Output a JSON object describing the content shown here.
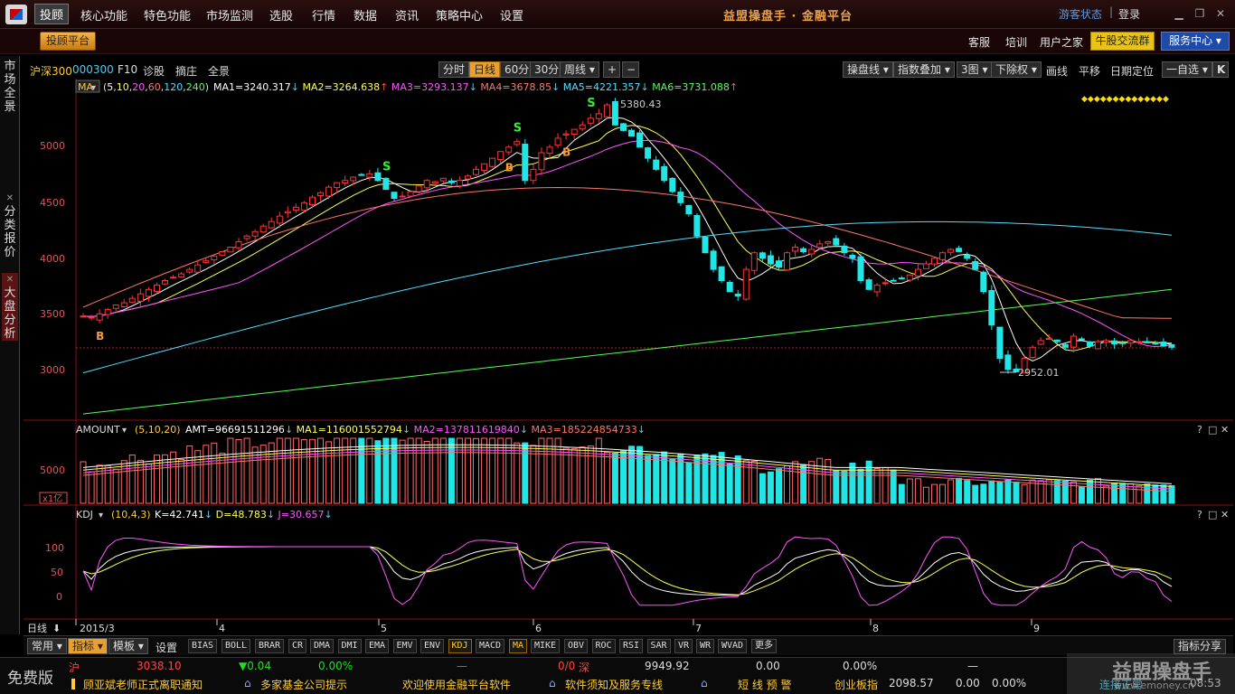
{
  "menu": {
    "items": [
      "投顾",
      "核心功能",
      "特色功能",
      "市场监测",
      "选股",
      "行情",
      "数据",
      "资讯",
      "策略中心",
      "设置"
    ],
    "app_title": "益盟操盘手 · 金融平台",
    "guest_status": "游客状态",
    "separator": "|",
    "login": "登录"
  },
  "toolbar": {
    "invest_platform": "投顾平台",
    "links": [
      "客服",
      "培训",
      "用户之家"
    ],
    "stock_exchange_group": "牛股交流群",
    "service_center": "服务中心"
  },
  "side_tabs": {
    "market_overview": "市场全景",
    "category_quotes": "分类报价",
    "index_analysis": "大盘分析",
    "close_symbol": "✕"
  },
  "chart_header": {
    "symbol_name": "沪深300",
    "symbol_code": "000300",
    "links": [
      "F10",
      "诊股",
      "摘庄",
      "全景"
    ],
    "periods": [
      "分时",
      "日线",
      "60分",
      "30分",
      "周线"
    ],
    "active_period": "日线",
    "right_buttons": [
      "操盘线",
      "指数叠加",
      "3图",
      "下除权"
    ],
    "right_links": [
      "画线",
      "平移",
      "日期定位"
    ],
    "self_select": "一自选"
  },
  "ma_legend": {
    "label": "MA",
    "params": [
      "5",
      "10",
      "20",
      "60",
      "120",
      "240"
    ],
    "items": [
      {
        "text": "MA1=3240.317",
        "arrow": "↓",
        "color": "#ffffff",
        "arrow_color": "#5ac8e6"
      },
      {
        "text": "MA2=3264.638",
        "arrow": "↑",
        "color": "#ffff55",
        "arrow_color": "#ff5555"
      },
      {
        "text": "MA3=3293.137",
        "arrow": "↓",
        "color": "#ff55ff",
        "arrow_color": "#5ac8e6"
      },
      {
        "text": "MA4=3678.85",
        "arrow": "↓",
        "color": "#ff7766",
        "arrow_color": "#5ac8e6"
      },
      {
        "text": "MA5=4221.357",
        "arrow": "↓",
        "color": "#55ddff",
        "arrow_color": "#5ac8e6"
      },
      {
        "text": "MA6=3731.088",
        "arrow": "↑",
        "color": "#55ff55",
        "arrow_color": "#ff5555"
      }
    ]
  },
  "amount_legend": {
    "label": "AMOUNT",
    "params": "(5,10,20)",
    "items": [
      {
        "text": "AMT=96691511296",
        "arrow": "↓",
        "color": "#ffffff"
      },
      {
        "text": "MA1=116001552794",
        "arrow": "↓",
        "color": "#ffff55"
      },
      {
        "text": "MA2=137811619840",
        "arrow": "↓",
        "color": "#ff55ff"
      },
      {
        "text": "MA3=185224854733",
        "arrow": "↓",
        "color": "#ff7766"
      }
    ],
    "unit_label": "x1亿"
  },
  "kdj_legend": {
    "label": "KDJ",
    "params": "(10,4,3)",
    "items": [
      {
        "text": "K=42.741",
        "arrow": "↓",
        "color": "#ffffff"
      },
      {
        "text": "D=48.783",
        "arrow": "↓",
        "color": "#ffff55"
      },
      {
        "text": "J=30.657",
        "arrow": "↓",
        "color": "#ff55ff"
      }
    ]
  },
  "panel_controls": [
    "?",
    "□",
    "✕"
  ],
  "chart_data": {
    "type": "candlestick",
    "price_axis_ticks": [
      "5000",
      "4500",
      "4000",
      "3500",
      "3000"
    ],
    "amount_axis_ticks": [
      "5000"
    ],
    "kdj_axis_ticks": [
      "100",
      "50",
      "0"
    ],
    "x_axis_labels": [
      "日线",
      "2015/3",
      "4",
      "5",
      "6",
      "7",
      "8",
      "9"
    ],
    "high_label": "5380.43",
    "low_label": "2952.01",
    "ref_price": 3182,
    "signals": [
      {
        "type": "B",
        "index": 2
      },
      {
        "type": "S",
        "index": 37
      },
      {
        "type": "S",
        "index": 53
      },
      {
        "type": "B",
        "index": 52
      },
      {
        "type": "S",
        "index": 62
      },
      {
        "type": "B",
        "index": 59
      }
    ],
    "closes": [
      3480,
      3470,
      3500,
      3540,
      3580,
      3600,
      3640,
      3680,
      3720,
      3760,
      3800,
      3830,
      3860,
      3900,
      3940,
      3980,
      4020,
      4060,
      4100,
      4150,
      4200,
      4240,
      4290,
      4330,
      4380,
      4420,
      4460,
      4500,
      4550,
      4590,
      4640,
      4680,
      4700,
      4730,
      4750,
      4760,
      4700,
      4620,
      4540,
      4560,
      4600,
      4650,
      4700,
      4690,
      4720,
      4680,
      4700,
      4740,
      4800,
      4850,
      4900,
      4960,
      5000,
      5050,
      4700,
      4800,
      4950,
      5000,
      5080,
      5120,
      5160,
      5200,
      5260,
      5300,
      5380,
      5200,
      5150,
      5100,
      5000,
      4900,
      4800,
      4700,
      4600,
      4500,
      4400,
      4200,
      4050,
      3900,
      3800,
      3700,
      3660,
      3900,
      4050,
      4000,
      3950,
      3920,
      4050,
      4100,
      4060,
      4080,
      4130,
      4150,
      4120,
      4050,
      4000,
      3800,
      3720,
      3760,
      3780,
      3800,
      3820,
      3850,
      3900,
      3950,
      4000,
      4050,
      4080,
      4060,
      4000,
      3900,
      3700,
      3400,
      3100,
      3000,
      2980,
      3100,
      3200,
      3260,
      3280,
      3250,
      3200,
      3300,
      3270,
      3210,
      3250,
      3260,
      3230,
      3240,
      3260,
      3250,
      3240,
      3230,
      3210,
      3200
    ],
    "ma_series": [
      {
        "name": "MA1",
        "color": "#ffffff"
      },
      {
        "name": "MA2",
        "color": "#ffff55"
      },
      {
        "name": "MA3",
        "color": "#ff55ff"
      },
      {
        "name": "MA4",
        "color": "#ff7766"
      },
      {
        "name": "MA5",
        "color": "#55ddff"
      },
      {
        "name": "MA6",
        "color": "#55ff55"
      }
    ],
    "yrange": [
      2560,
      5470
    ]
  },
  "indicator_bar": {
    "common": "常用",
    "indicator": "指标",
    "template": "模板",
    "settings": "设置",
    "tabs": [
      "BIAS",
      "BOLL",
      "BRAR",
      "CR",
      "DMA",
      "DMI",
      "EMA",
      "EMV",
      "ENV",
      "KDJ",
      "MACD",
      "MA",
      "MIKE",
      "OBV",
      "ROC",
      "RSI",
      "SAR",
      "VR",
      "WR",
      "WVAD",
      "更多"
    ],
    "active_tabs": [
      "KDJ",
      "MA"
    ],
    "share": "指标分享"
  },
  "statusbar": {
    "free_version": "免费版",
    "sh_label": "沪",
    "sh_value": "3038.10",
    "sh_change": "▼0.04",
    "sh_pct": "0.00%",
    "dash1": "—",
    "ratio": "0/0",
    "sz_label": "深",
    "sz_value": "9949.92",
    "sz_change": "0.00",
    "sz_pct": "0.00%",
    "dash2": "—",
    "news": [
      "顾亚斌老师正式离职通知",
      "多家基金公司提示",
      "欢迎使用金融平台软件",
      "软件须知及服务专线"
    ],
    "short_alert": "短 线 预 警",
    "cyb_label": "创业板指",
    "cyb_value": "2098.57",
    "cyb_change": "0.00",
    "cyb_pct": "0.00%",
    "connection": "连接正常",
    "time": "08:53",
    "watermark": "益盟操盘手",
    "watermark_url": "www.emoney.cn"
  }
}
